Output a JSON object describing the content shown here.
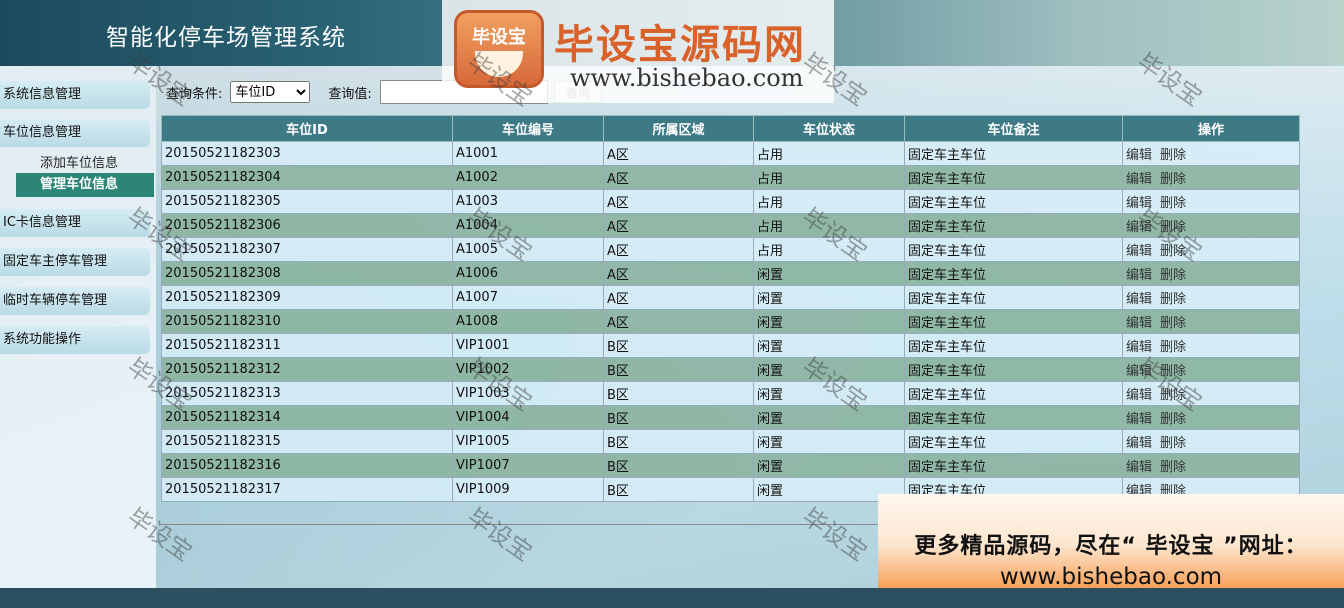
{
  "app": {
    "title": "智能化停车场管理系统"
  },
  "logo": {
    "badge": "毕设宝",
    "title": "毕设宝源码网",
    "url": "www.bishebao.com"
  },
  "sidebar": {
    "items": [
      {
        "label": "系统信息管理"
      },
      {
        "label": "车位信息管理",
        "children": [
          {
            "label": "添加车位信息"
          },
          {
            "label": "管理车位信息",
            "active": true
          }
        ]
      },
      {
        "label": "IC卡信息管理"
      },
      {
        "label": "固定车主停车管理"
      },
      {
        "label": "临时车辆停车管理"
      },
      {
        "label": "系统功能操作"
      }
    ]
  },
  "query": {
    "condition_label": "查询条件:",
    "condition_selected": "车位ID",
    "value_label": "查询值:",
    "value": "",
    "button_label": "查询"
  },
  "table": {
    "headers": [
      "车位ID",
      "车位编号",
      "所属区域",
      "车位状态",
      "车位备注",
      "操作"
    ],
    "edit_label": "编辑",
    "delete_label": "删除",
    "rows": [
      [
        "20150521182303",
        "A1001",
        "A区",
        "占用",
        "固定车主车位"
      ],
      [
        "20150521182304",
        "A1002",
        "A区",
        "占用",
        "固定车主车位"
      ],
      [
        "20150521182305",
        "A1003",
        "A区",
        "占用",
        "固定车主车位"
      ],
      [
        "20150521182306",
        "A1004",
        "A区",
        "占用",
        "固定车主车位"
      ],
      [
        "20150521182307",
        "A1005",
        "A区",
        "占用",
        "固定车主车位"
      ],
      [
        "20150521182308",
        "A1006",
        "A区",
        "闲置",
        "固定车主车位"
      ],
      [
        "20150521182309",
        "A1007",
        "A区",
        "闲置",
        "固定车主车位"
      ],
      [
        "20150521182310",
        "A1008",
        "A区",
        "闲置",
        "固定车主车位"
      ],
      [
        "20150521182311",
        "VIP1001",
        "B区",
        "闲置",
        "固定车主车位"
      ],
      [
        "20150521182312",
        "VIP1002",
        "B区",
        "闲置",
        "固定车主车位"
      ],
      [
        "20150521182313",
        "VIP1003",
        "B区",
        "闲置",
        "固定车主车位"
      ],
      [
        "20150521182314",
        "VIP1004",
        "B区",
        "闲置",
        "固定车主车位"
      ],
      [
        "20150521182315",
        "VIP1005",
        "B区",
        "闲置",
        "固定车主车位"
      ],
      [
        "20150521182316",
        "VIP1007",
        "B区",
        "闲置",
        "固定车主车位"
      ],
      [
        "20150521182317",
        "VIP1009",
        "B区",
        "闲置",
        "固定车主车位"
      ]
    ]
  },
  "watermark": "毕设宝",
  "ad": {
    "line1": "更多精品源码，尽在“ 毕设宝 ”网址：",
    "line2": "www.bishebao.com"
  }
}
